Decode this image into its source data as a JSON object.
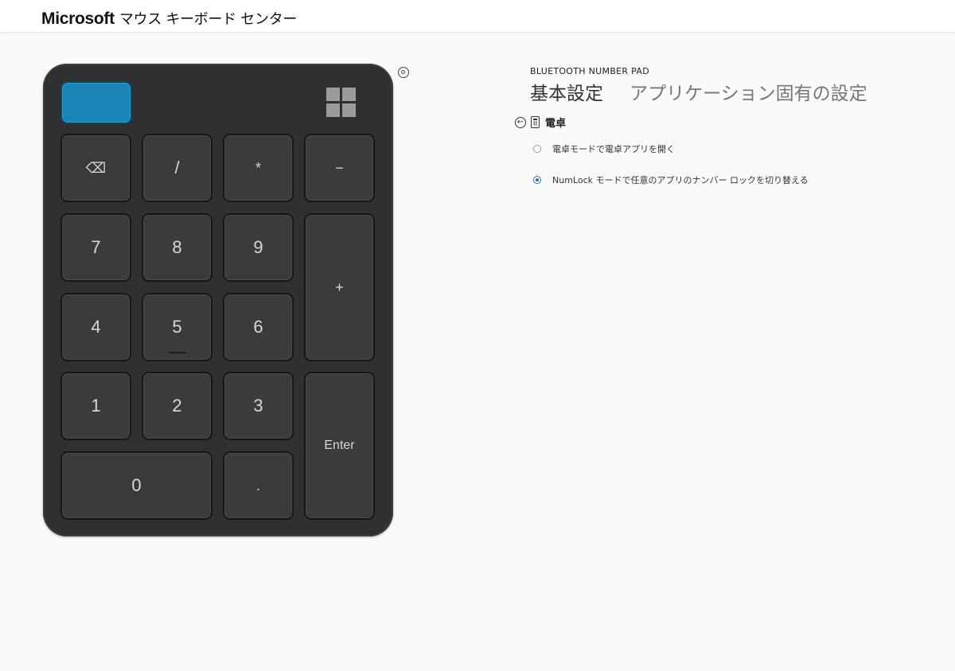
{
  "app": {
    "brand": "Microsoft",
    "product": "マウス キーボード センター"
  },
  "device": {
    "name": "BLUETOOTH NUMBER PAD",
    "body_color": "#2f3031",
    "fn_key_color": "#1a86b8",
    "keys": {
      "fn": "",
      "backspace": "⌫",
      "divide": "/",
      "multiply": "*",
      "minus": "−",
      "k7": "7",
      "k8": "8",
      "k9": "9",
      "plus": "+",
      "k4": "4",
      "k5": "5",
      "k6": "6",
      "k1": "1",
      "k2": "2",
      "k3": "3",
      "enter": "Enter",
      "k0": "0",
      "decimal": "."
    }
  },
  "tabs": [
    {
      "label": "基本設定",
      "active": true
    },
    {
      "label": "アプリケーション固有の設定",
      "active": false
    }
  ],
  "section": {
    "title": "電卓",
    "options": [
      {
        "label": "電卓モードで電卓アプリを開く",
        "checked": false
      },
      {
        "label": "NumLock モードで任意のアプリのナンバー ロックを切り替える",
        "checked": true
      }
    ]
  },
  "colors": {
    "accent": "#2a6fb8"
  }
}
